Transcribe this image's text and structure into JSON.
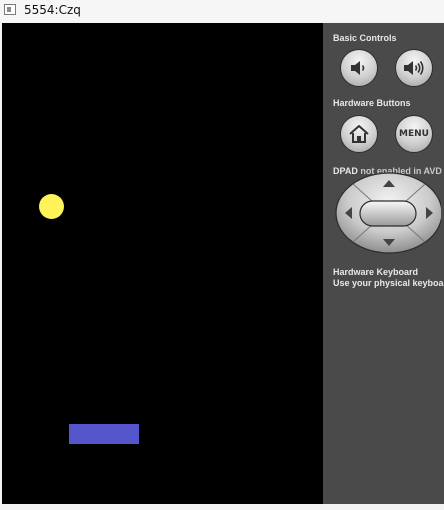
{
  "window": {
    "title": "5554:Czq"
  },
  "game": {
    "ball_color": "#fff35a",
    "paddle_color": "#5555cc",
    "background": "#000000"
  },
  "panel": {
    "basic_controls_label": "Basic Controls",
    "hardware_buttons_label": "Hardware Buttons",
    "menu_label": "MENU",
    "dpad_label": "DPAD",
    "dpad_note": "not enabled in AVD",
    "keyboard_label": "Hardware Keyboard",
    "keyboard_note": "Use your physical keyboard"
  }
}
